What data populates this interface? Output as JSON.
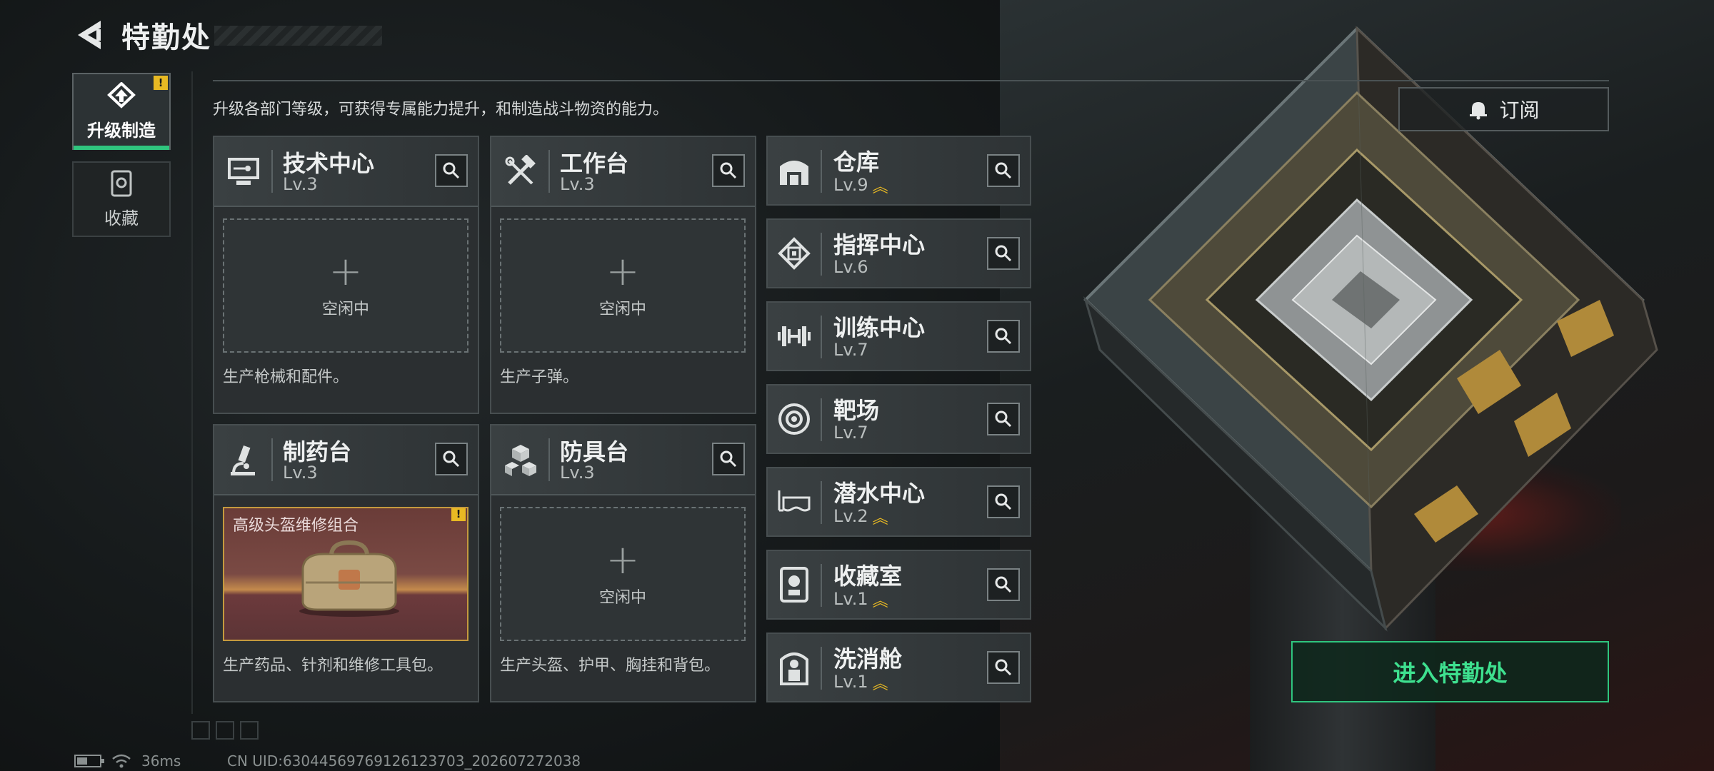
{
  "header": {
    "title": "特勤处"
  },
  "sidebar": {
    "items": [
      {
        "label": "升级制造",
        "active": true,
        "badge": "!"
      },
      {
        "label": "收藏",
        "active": false
      }
    ]
  },
  "subtitle": "升级各部门等级，可获得专属能力提升，和制造战斗物资的能力。",
  "subscribe_label": "订阅",
  "enter_label": "进入特勤处",
  "production": [
    {
      "name": "技术中心",
      "level": "Lv.3",
      "slot_plus": "+",
      "slot_state": "空闲中",
      "desc": "生产枪械和配件。"
    },
    {
      "name": "工作台",
      "level": "Lv.3",
      "slot_plus": "+",
      "slot_state": "空闲中",
      "desc": "生产子弹。"
    },
    {
      "name": "制药台",
      "level": "Lv.3",
      "product_name": "高级头盔维修组合",
      "badge": "!",
      "desc": "生产药品、针剂和维修工具包。"
    },
    {
      "name": "防具台",
      "level": "Lv.3",
      "slot_plus": "+",
      "slot_state": "空闲中",
      "desc": "生产头盔、护甲、胸挂和背包。"
    }
  ],
  "facilities": [
    {
      "name": "仓库",
      "level": "Lv.9",
      "upgradable": true
    },
    {
      "name": "指挥中心",
      "level": "Lv.6",
      "upgradable": false
    },
    {
      "name": "训练中心",
      "level": "Lv.7",
      "upgradable": false
    },
    {
      "name": "靶场",
      "level": "Lv.7",
      "upgradable": false
    },
    {
      "name": "潜水中心",
      "level": "Lv.2",
      "upgradable": true
    },
    {
      "name": "收藏室",
      "level": "Lv.1",
      "upgradable": true
    },
    {
      "name": "洗消舱",
      "level": "Lv.1",
      "upgradable": true
    }
  ],
  "status": {
    "ping": "36ms",
    "uid": "CN UID:63044569769126123703_202607272038"
  },
  "colors": {
    "accent_green": "#2fc57e",
    "warning_yellow": "#e8b923",
    "card_bg": "#2b2f31"
  }
}
